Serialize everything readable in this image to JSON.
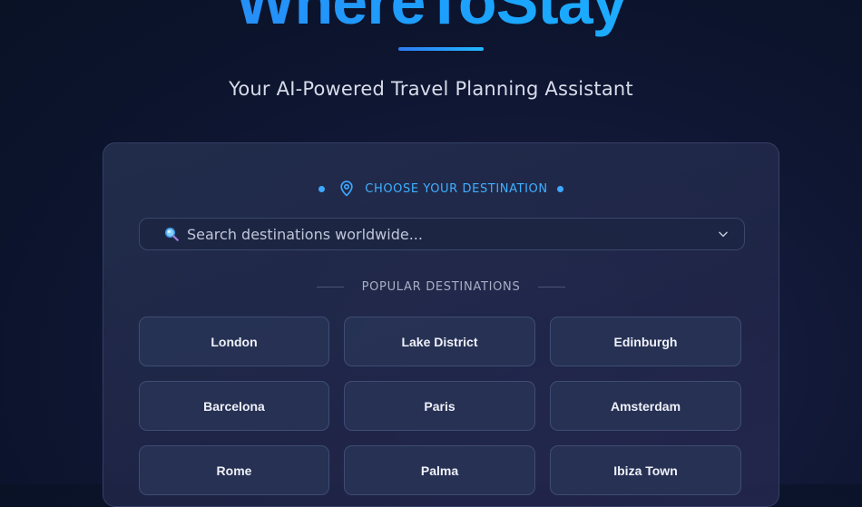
{
  "brand": {
    "title": "WhereToStay"
  },
  "hero": {
    "tagline": "Your AI-Powered Travel Planning Assistant"
  },
  "destination_picker": {
    "heading": "CHOOSE YOUR DESTINATION",
    "search": {
      "placeholder": "Search destinations worldwide...",
      "value": ""
    },
    "popular_heading": "POPULAR DESTINATIONS",
    "popular": [
      "London",
      "Lake District",
      "Edinburgh",
      "Barcelona",
      "Paris",
      "Amsterdam",
      "Rome",
      "Palma",
      "Ibiza Town"
    ]
  },
  "colors": {
    "accent": "#3fb0ff",
    "brand_gradient_start": "#2f7bf0",
    "brand_gradient_end": "#22b8ff"
  },
  "icons": {
    "destination_marker": "map-pin-icon",
    "search": "search-icon",
    "dropdown": "chevron-down-icon"
  }
}
